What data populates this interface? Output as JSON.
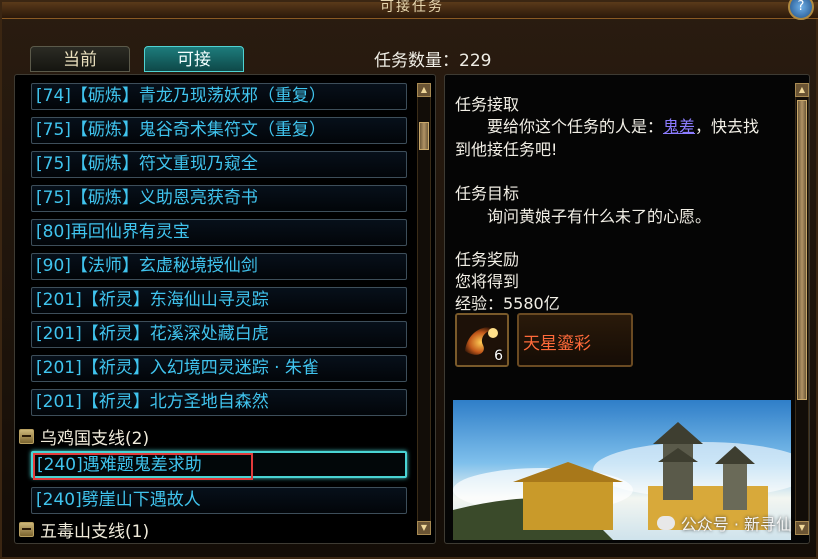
{
  "window": {
    "title": "可接任务",
    "help_symbol": "?"
  },
  "tabs": [
    {
      "label": "当前",
      "active": false
    },
    {
      "label": "可接",
      "active": true
    }
  ],
  "quest_count_text": "任务数量：229",
  "quest_list": {
    "items": [
      "[74]【砺炼】青龙乃现荡妖邪（重复）",
      "[75]【砺炼】鬼谷奇术集符文（重复）",
      "[75]【砺炼】符文重现乃窥全",
      "[75]【砺炼】义助恩亮获奇书",
      "[80]再回仙界有灵宝",
      "[90]【法师】玄虚秘境授仙剑",
      "[201]【祈灵】东海仙山寻灵踪",
      "[201]【祈灵】花溪深处藏白虎",
      "[201]【祈灵】入幻境四灵迷踪 · 朱雀",
      "[201]【祈灵】北方圣地自森然"
    ],
    "group1": "乌鸡国支线(2)",
    "group1_items": [
      "[240]遇难题鬼差求助",
      "[240]劈崖山下遇故人"
    ],
    "group2": "五毒山支线(1)"
  },
  "detail": {
    "accept_heading": "任务接取",
    "accept_line1_prefix": "要给你这个任务的人是：",
    "npc_name": "鬼差",
    "accept_line1_suffix": "，快去找",
    "accept_line2": "到他接任务吧!",
    "goal_heading": "任务目标",
    "goal_text": "询问黄娘子有什么未了的心愿。",
    "reward_heading": "任务奖励",
    "reward_intro": "您将得到",
    "exp_text": "经验：5580亿",
    "reward_item_name": "天星鎏彩",
    "reward_item_qty": "6"
  },
  "watermark": "公众号 · 新寻仙",
  "colors": {
    "quest_text": "#40c4ee",
    "selected_border": "#49d4d4",
    "highlight_box": "#e23b3b",
    "npc_link": "#8c7cff",
    "reward_name": "#ff6a3a"
  }
}
